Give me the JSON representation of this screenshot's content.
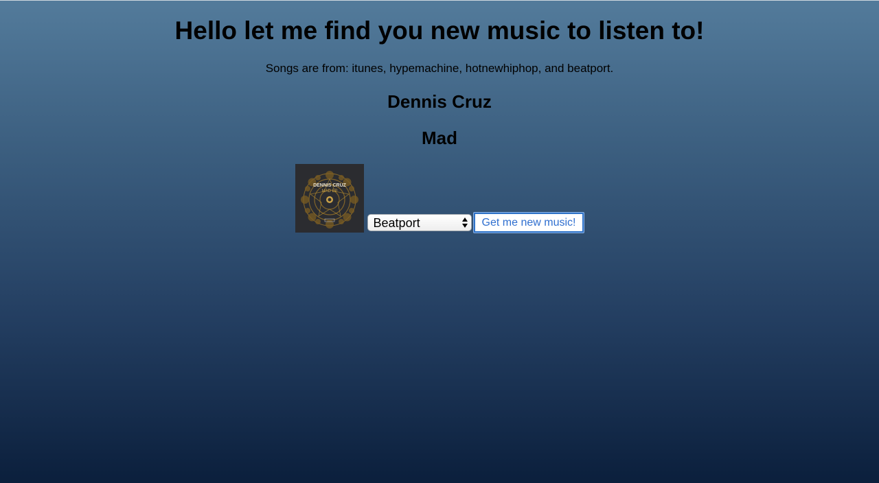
{
  "header": {
    "title": "Hello let me find you new music to listen to!",
    "subtitle": "Songs are from: itunes, hypemachine, hotnewhiphop, and beatport."
  },
  "song": {
    "artist": "Dennis Cruz",
    "track": "Mad",
    "cover": {
      "artist_text": "DENNIS CRUZ",
      "release_text": "MAD EP",
      "background_color": "#2b2c30",
      "pattern_color": "#8a6a2a"
    }
  },
  "controls": {
    "source_select": {
      "selected": "Beatport"
    },
    "submit_label": "Get me new music!"
  },
  "colors": {
    "gradient_top": "#537b9b",
    "gradient_bottom": "#0b1f3c",
    "button_text": "#2f6fd0",
    "button_border": "#2f73c8"
  }
}
